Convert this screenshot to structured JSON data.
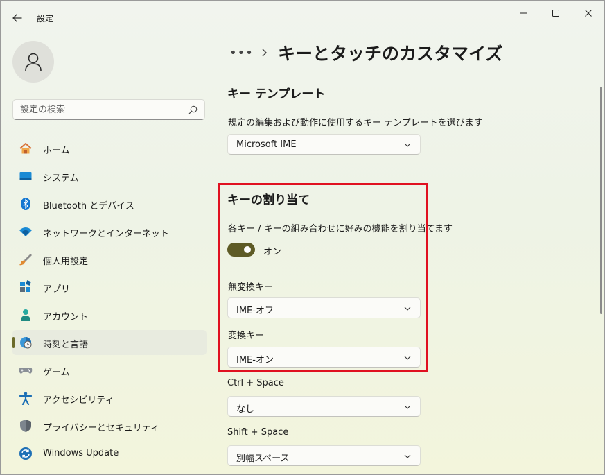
{
  "window": {
    "app_title": "設定"
  },
  "sidebar": {
    "search_placeholder": "設定の検索",
    "items": [
      {
        "label": "ホーム",
        "icon": "home-icon",
        "active": false
      },
      {
        "label": "システム",
        "icon": "system-display-icon",
        "active": false
      },
      {
        "label": "Bluetooth とデバイス",
        "icon": "bluetooth-icon",
        "active": false
      },
      {
        "label": "ネットワークとインターネット",
        "icon": "wifi-icon",
        "active": false
      },
      {
        "label": "個人用設定",
        "icon": "paintbrush-icon",
        "active": false
      },
      {
        "label": "アプリ",
        "icon": "apps-icon",
        "active": false
      },
      {
        "label": "アカウント",
        "icon": "account-icon",
        "active": false
      },
      {
        "label": "時刻と言語",
        "icon": "time-language-icon",
        "active": true
      },
      {
        "label": "ゲーム",
        "icon": "gamepad-icon",
        "active": false
      },
      {
        "label": "アクセシビリティ",
        "icon": "accessibility-icon",
        "active": false
      },
      {
        "label": "プライバシーとセキュリティ",
        "icon": "shield-icon",
        "active": false
      },
      {
        "label": "Windows Update",
        "icon": "windows-update-icon",
        "active": false
      }
    ]
  },
  "main": {
    "breadcrumb_more": "•••",
    "page_title": "キーとタッチのカスタマイズ",
    "key_template": {
      "title": "キー テンプレート",
      "description": "規定の編集および動作に使用するキー テンプレートを選びます",
      "selected": "Microsoft IME"
    },
    "key_assignment": {
      "title": "キーの割り当て",
      "description": "各キー / キーの組み合わせに好みの機能を割り当てます",
      "toggle_on": true,
      "toggle_label": "オン",
      "fields": [
        {
          "label": "無変換キー",
          "value": "IME-オフ"
        },
        {
          "label": "変換キー",
          "value": "IME-オン"
        },
        {
          "label": "Ctrl + Space",
          "value": "なし"
        },
        {
          "label": "Shift + Space",
          "value": "別幅スペース"
        }
      ]
    }
  },
  "colors": {
    "accent": "#5e5b26",
    "highlight_border": "#e01020",
    "background": "#eef3e6"
  }
}
